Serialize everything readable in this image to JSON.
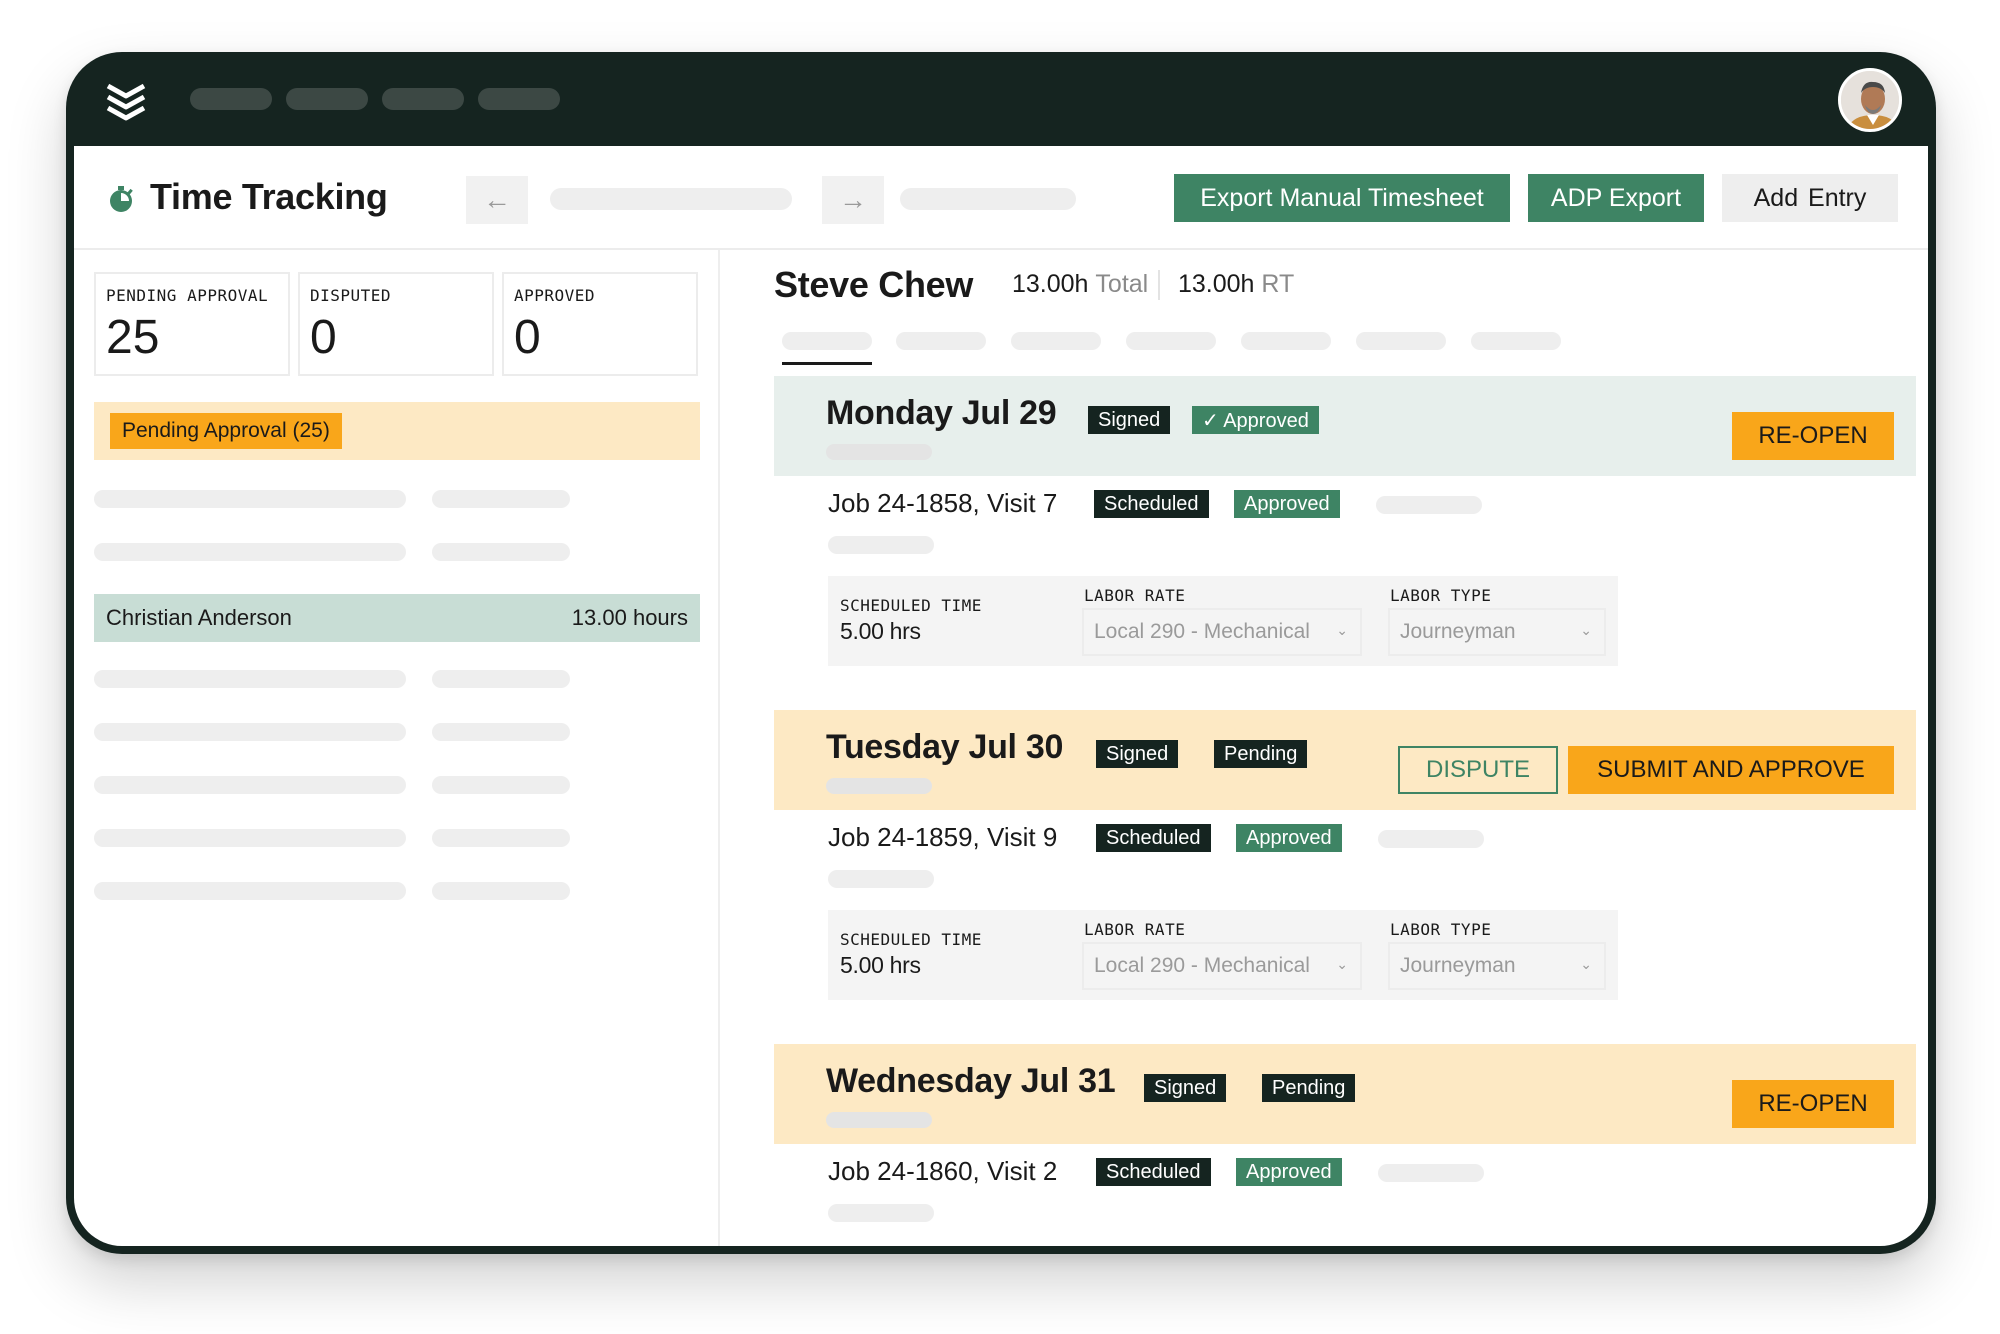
{
  "header": {
    "title": "Time Tracking",
    "back_icon": "←",
    "forward_icon": "→",
    "buttons": {
      "export_manual": "Export Manual Timesheet",
      "adp_export": "ADP Export",
      "add_entry": "Add  Entry"
    }
  },
  "stats": [
    {
      "label": "PENDING APPROVAL",
      "value": "25"
    },
    {
      "label": "DISPUTED",
      "value": "0"
    },
    {
      "label": "APPROVED",
      "value": "0"
    }
  ],
  "filter": {
    "pending_label": "Pending Approval (25)"
  },
  "employee_list": {
    "selected": {
      "name": "Christian Anderson",
      "hours": "13.00 hours"
    }
  },
  "detail": {
    "employee_name": "Steve Chew",
    "total_value": "13.00h",
    "total_label": "Total",
    "rt_value": "13.00h",
    "rt_label": "RT",
    "days": [
      {
        "title": "Monday Jul 29",
        "badges": [
          "Signed",
          "✓ Approved"
        ],
        "action": "RE-OPEN",
        "job": {
          "title": "Job 24-1858, Visit 7",
          "badges": [
            "Scheduled",
            "Approved"
          ],
          "scheduled_label": "SCHEDULED TIME",
          "scheduled_value": "5.00 hrs",
          "labor_rate_label": "LABOR RATE",
          "labor_rate_value": "Local 290 - Mechanical",
          "labor_type_label": "LABOR TYPE",
          "labor_type_value": "Journeyman"
        }
      },
      {
        "title": "Tuesday Jul 30",
        "badges": [
          "Signed",
          "Pending"
        ],
        "dispute_action": "DISPUTE",
        "action": "SUBMIT AND APPROVE",
        "job": {
          "title": "Job 24-1859, Visit 9",
          "badges": [
            "Scheduled",
            "Approved"
          ],
          "scheduled_label": "SCHEDULED TIME",
          "scheduled_value": "5.00 hrs",
          "labor_rate_label": "LABOR RATE",
          "labor_rate_value": "Local 290 - Mechanical",
          "labor_type_label": "LABOR TYPE",
          "labor_type_value": "Journeyman"
        }
      },
      {
        "title": "Wednesday Jul 31",
        "badges": [
          "Signed",
          "Pending"
        ],
        "action": "RE-OPEN",
        "job": {
          "title": "Job 24-1860, Visit 2",
          "badges": [
            "Scheduled",
            "Approved"
          ]
        }
      }
    ]
  },
  "colors": {
    "brand_dark": "#152420",
    "brand_green": "#3e8464",
    "accent_orange": "#f9a61a",
    "pending_bg": "#fde9c4",
    "approved_bg": "#e7efec",
    "selected_row": "#c8ddd5"
  },
  "icons": {
    "logo": "stacked-chevrons-logo",
    "timer": "stopwatch-icon",
    "chevron": "chevron-down-icon",
    "check": "checkmark-icon"
  }
}
